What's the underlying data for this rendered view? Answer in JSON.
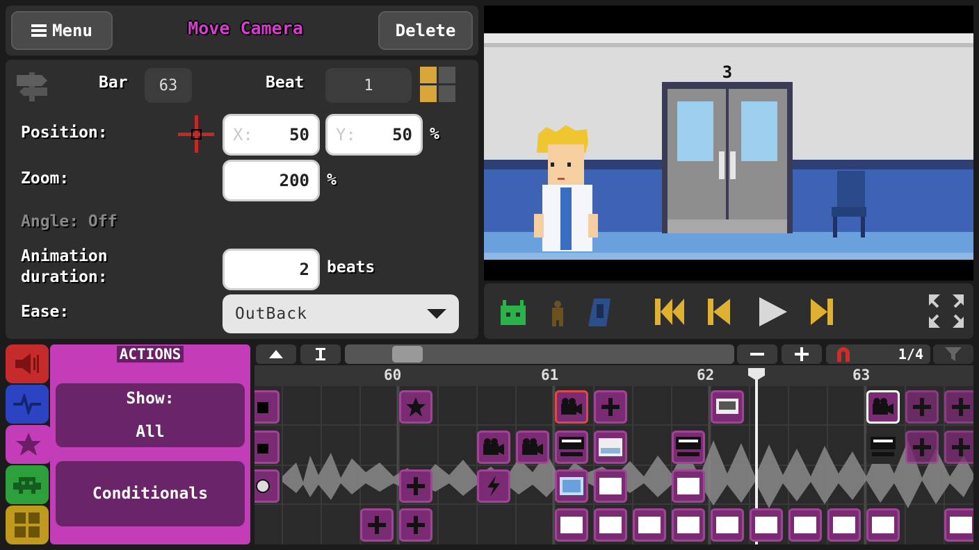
{
  "header": {
    "menu_label": "Menu",
    "title": "Move Camera",
    "delete_label": "Delete"
  },
  "props": {
    "bar_label": "Bar",
    "bar_value": "63",
    "beat_label": "Beat",
    "beat_value": "1",
    "position_label": "Position:",
    "x_placeholder": "X:",
    "x_value": "50",
    "y_placeholder": "Y:",
    "y_value": "50",
    "pos_unit": "%",
    "zoom_label": "Zoom:",
    "zoom_value": "200",
    "zoom_unit": "%",
    "angle_label": "Angle: Off",
    "anim_label_1": "Animation",
    "anim_label_2": "duration:",
    "anim_value": "2",
    "anim_unit": "beats",
    "ease_label": "Ease:",
    "ease_value": "OutBack"
  },
  "preview": {
    "room_number": "3"
  },
  "bottom": {
    "actions_title": "ACTIONS",
    "show_label": "Show:",
    "show_value": "All",
    "conditionals_label": "Conditionals",
    "snap_value": "1/4",
    "ruler": [
      "60",
      "61",
      "62",
      "63"
    ]
  },
  "colors": {
    "accent_magenta": "#d83bd0",
    "panel": "#2e2e2e",
    "gold": "#e0b030",
    "green": "#29b34a"
  },
  "icons": [
    "hamburger-icon",
    "signpost-icon",
    "crosshair-icon",
    "chevron-down-icon",
    "robot-icon",
    "metronome-icon",
    "player-icon",
    "skip-start-icon",
    "step-back-icon",
    "play-icon",
    "step-forward-icon",
    "fullscreen-icon",
    "sound-icon",
    "pulse-icon",
    "star-icon",
    "invader-icon",
    "grid-icon",
    "magnet-icon",
    "filter-icon"
  ]
}
